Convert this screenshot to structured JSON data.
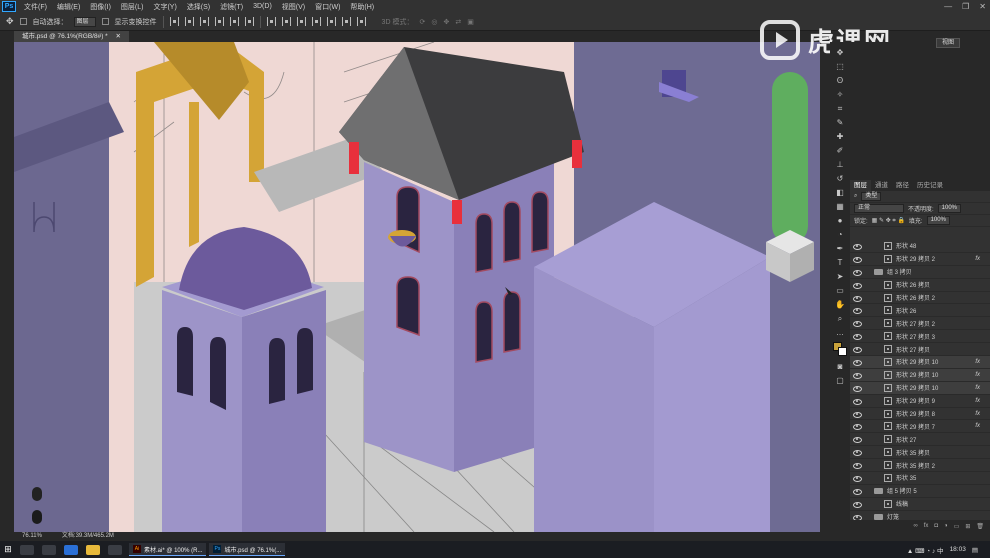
{
  "menubar": {
    "items": [
      "文件(F)",
      "编辑(E)",
      "图像(I)",
      "图层(L)",
      "文字(Y)",
      "选择(S)",
      "滤镜(T)",
      "3D(D)",
      "视图(V)",
      "窗口(W)",
      "帮助(H)"
    ]
  },
  "options": {
    "auto_select": "自动选择：",
    "auto_select_value": "图层",
    "transform": "显示变换控件",
    "mode_3d": "3D 模式："
  },
  "document": {
    "tab_title": "城市.psd @ 76.1%(RGB/8#) *",
    "zoom": "76.11%",
    "doc_size": "文档:39.3M/465.2M"
  },
  "watermark": {
    "brand": "虎课网"
  },
  "properties": {
    "button": "视图"
  },
  "layers_panel": {
    "tabs": [
      "图层",
      "通道",
      "路径",
      "历史记录"
    ],
    "filter": "类型",
    "blend": "正常",
    "opacity_label": "不透明度:",
    "opacity": "100%",
    "lock_label": "锁定:",
    "fill_label": "填充:",
    "fill": "100%",
    "layers": [
      {
        "name": "形状 48",
        "kind": "shape",
        "fx": ""
      },
      {
        "name": "形状 29 拷贝 2",
        "kind": "shape",
        "fx": "fx"
      },
      {
        "name": "组 3 拷贝",
        "kind": "group",
        "fx": ""
      },
      {
        "name": "形状 26 拷贝",
        "kind": "shape",
        "fx": ""
      },
      {
        "name": "形状 26 拷贝 2",
        "kind": "shape",
        "fx": ""
      },
      {
        "name": "形状 26",
        "kind": "shape",
        "fx": ""
      },
      {
        "name": "形状 27 拷贝 2",
        "kind": "shape",
        "fx": ""
      },
      {
        "name": "形状 27 拷贝 3",
        "kind": "shape",
        "fx": ""
      },
      {
        "name": "形状 27 拷贝",
        "kind": "shape",
        "fx": ""
      },
      {
        "name": "形状 29 拷贝 10",
        "kind": "shape",
        "fx": "fx",
        "selected": true
      },
      {
        "name": "形状 29 拷贝 10",
        "kind": "shape",
        "fx": "fx",
        "selected": true
      },
      {
        "name": "形状 29 拷贝 10",
        "kind": "shape",
        "fx": "fx",
        "selected": true
      },
      {
        "name": "形状 29 拷贝 9",
        "kind": "shape",
        "fx": "fx"
      },
      {
        "name": "形状 29 拷贝 8",
        "kind": "shape",
        "fx": "fx"
      },
      {
        "name": "形状 29 拷贝 7",
        "kind": "shape",
        "fx": "fx"
      },
      {
        "name": "形状 27",
        "kind": "shape",
        "fx": ""
      },
      {
        "name": "形状 35 拷贝",
        "kind": "shape",
        "fx": ""
      },
      {
        "name": "形状 35 拷贝 2",
        "kind": "shape",
        "fx": ""
      },
      {
        "name": "形状 35",
        "kind": "shape",
        "fx": ""
      },
      {
        "name": "组 5 拷贝 5",
        "kind": "group",
        "fx": ""
      },
      {
        "name": "线稿",
        "kind": "brush",
        "fx": ""
      },
      {
        "name": "灯笼",
        "kind": "group",
        "fx": ""
      }
    ]
  },
  "taskbar": {
    "apps": [
      {
        "badge": "Ai",
        "label": "素材.ai* @ 100% (R...",
        "color": "#ff9a00"
      },
      {
        "badge": "Ps",
        "label": "城市.psd @ 76.1%(...",
        "color": "#31a8ff"
      }
    ],
    "time": "18:03"
  },
  "colors": {
    "canvas_bg": "#efd8d4",
    "building": "#8a80b8",
    "roof": "#3c3c3e",
    "accent_red": "#e8303c",
    "accent_yellow": "#d4a436",
    "green": "#5fae5f"
  }
}
